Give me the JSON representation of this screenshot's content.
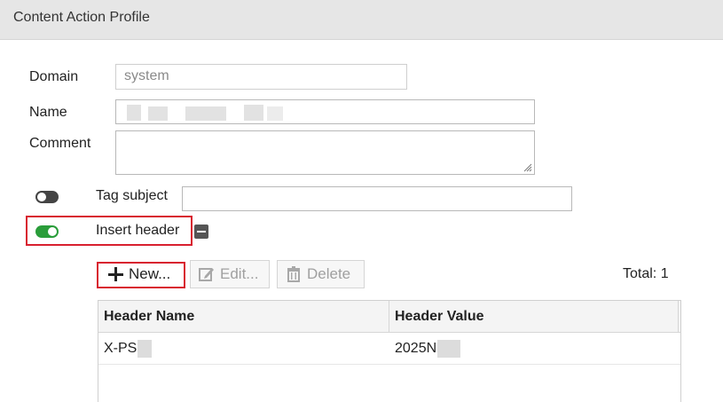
{
  "window": {
    "title": "Content Action Profile"
  },
  "form": {
    "domain_label": "Domain",
    "domain_value": "system",
    "name_label": "Name",
    "name_value": "",
    "comment_label": "Comment",
    "comment_value": "",
    "tag_subject_label": "Tag subject",
    "tag_subject_enabled": false,
    "tag_subject_value": "",
    "insert_header_label": "Insert header",
    "insert_header_enabled": true
  },
  "toolbar": {
    "new_label": "New...",
    "edit_label": "Edit...",
    "delete_label": "Delete",
    "total_text": "Total: 1"
  },
  "table": {
    "columns": [
      "Header Name",
      "Header Value"
    ],
    "rows": [
      {
        "name": "X-PS",
        "value": "2025N"
      }
    ]
  },
  "colors": {
    "toggle_on": "#2a9d3a",
    "toggle_off": "#444444",
    "highlight_box": "#d8202f"
  },
  "icons": [
    "plus-icon",
    "edit-icon",
    "trash-icon",
    "minus-icon",
    "resize-grip-icon"
  ]
}
